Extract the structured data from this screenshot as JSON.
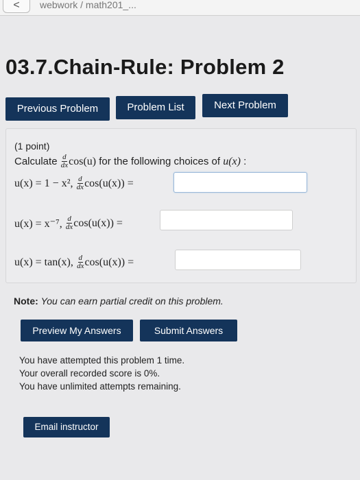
{
  "topbar": {
    "back_glyph": "<",
    "breadcrumb": "webwork / math201_..."
  },
  "page": {
    "title": "03.7.Chain-Rule: Problem 2"
  },
  "nav": {
    "previous": "Previous Problem",
    "list": "Problem List",
    "next": "Next Problem"
  },
  "problem": {
    "points": "(1 point)",
    "intro_prefix": "Calculate",
    "intro_expr": "cos(u)",
    "intro_suffix": "for the following choices of",
    "intro_var": "u(x)",
    "intro_colon": ":",
    "d_num": "d",
    "d_den": "dx",
    "rows": [
      {
        "choice": "u(x) = 1 − x²,",
        "rhs": "cos(u(x)) =",
        "value": ""
      },
      {
        "choice": "u(x) = x⁻⁷,",
        "rhs": "cos(u(x)) =",
        "value": ""
      },
      {
        "choice": "u(x) = tan(x),",
        "rhs": "cos(u(x)) =",
        "value": ""
      }
    ]
  },
  "note": {
    "label": "Note:",
    "text": "You can earn partial credit on this problem."
  },
  "actions": {
    "preview": "Preview My Answers",
    "submit": "Submit Answers"
  },
  "status": {
    "attempted": "You have attempted this problem 1 time.",
    "score": "Your overall recorded score is 0%.",
    "remaining": "You have unlimited attempts remaining."
  },
  "email": {
    "label": "Email instructor"
  },
  "colors": {
    "button_bg": "#14345a",
    "page_bg": "#e9e9eb"
  }
}
